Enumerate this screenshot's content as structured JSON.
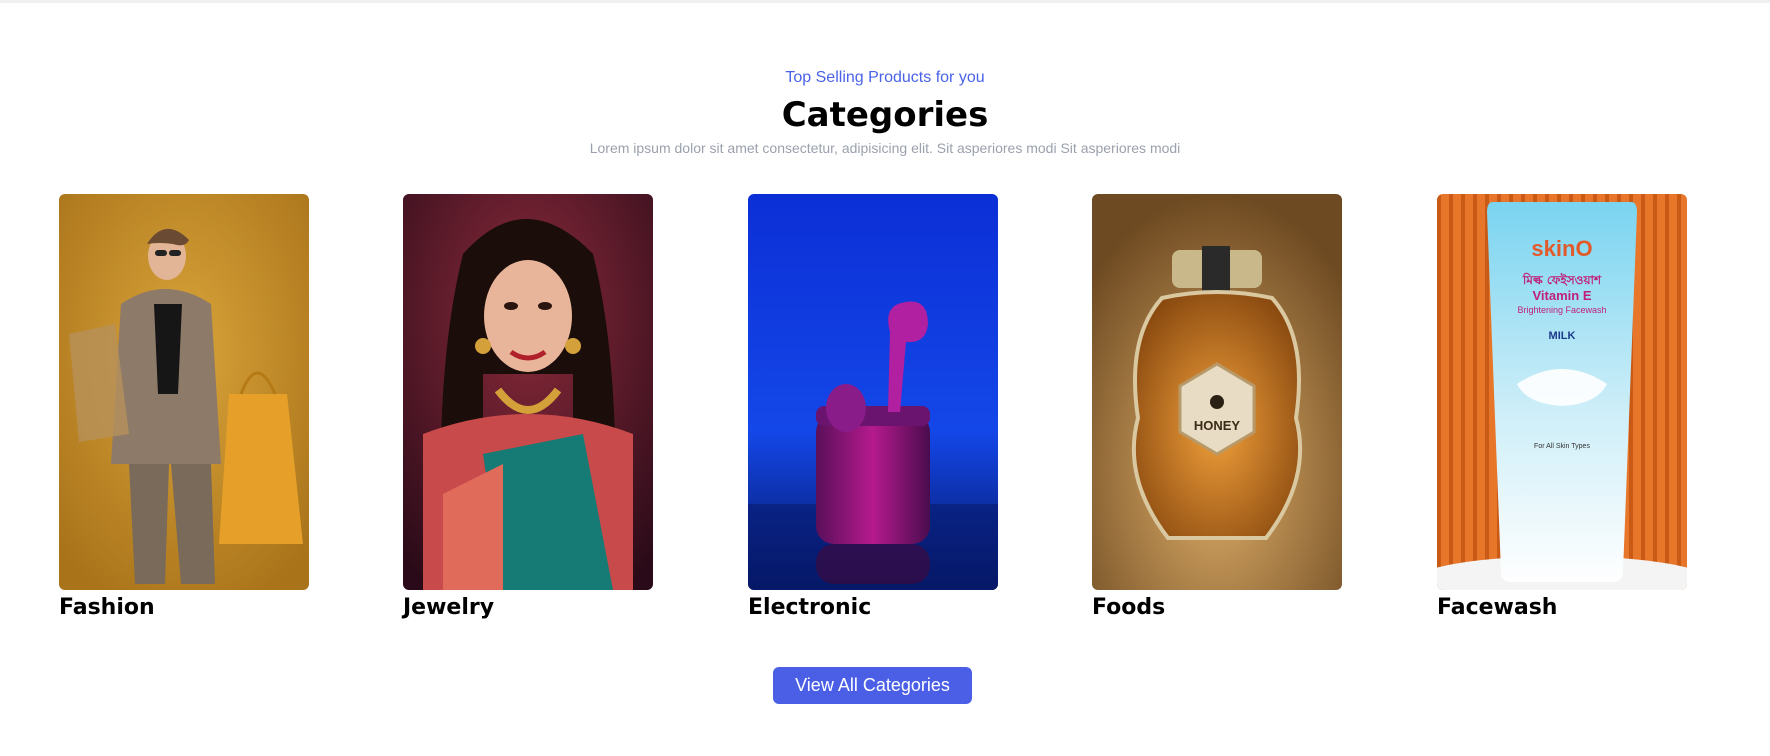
{
  "section": {
    "eyebrow": "Top Selling Products for you",
    "title": "Categories",
    "description": "Lorem ipsum dolor sit amet consectetur, adipisicing elit. Sit asperiores modi Sit asperiores modi"
  },
  "categories": [
    {
      "label": "Fashion",
      "image": "fashion-photo"
    },
    {
      "label": "Jewelry",
      "image": "jewelry-photo"
    },
    {
      "label": "Electronic",
      "image": "earbuds-photo"
    },
    {
      "label": "Foods",
      "image": "honey-jar-photo"
    },
    {
      "label": "Facewash",
      "image": "facewash-tube-photo"
    }
  ],
  "product_text": {
    "honey_label": "HONEY",
    "facewash_brand": "skinO",
    "facewash_bengali": "মিল্ক ফেইসওয়াশ",
    "facewash_vitamin": "Vitamin E",
    "facewash_tagline": "Brightening Facewash",
    "facewash_milk": "MILK",
    "facewash_skin": "For All Skin Types"
  },
  "cta": {
    "label": "View All Categories"
  },
  "colors": {
    "accent": "#4a63e7",
    "button": "#4a5fe6",
    "muted": "#9aa1ad"
  }
}
